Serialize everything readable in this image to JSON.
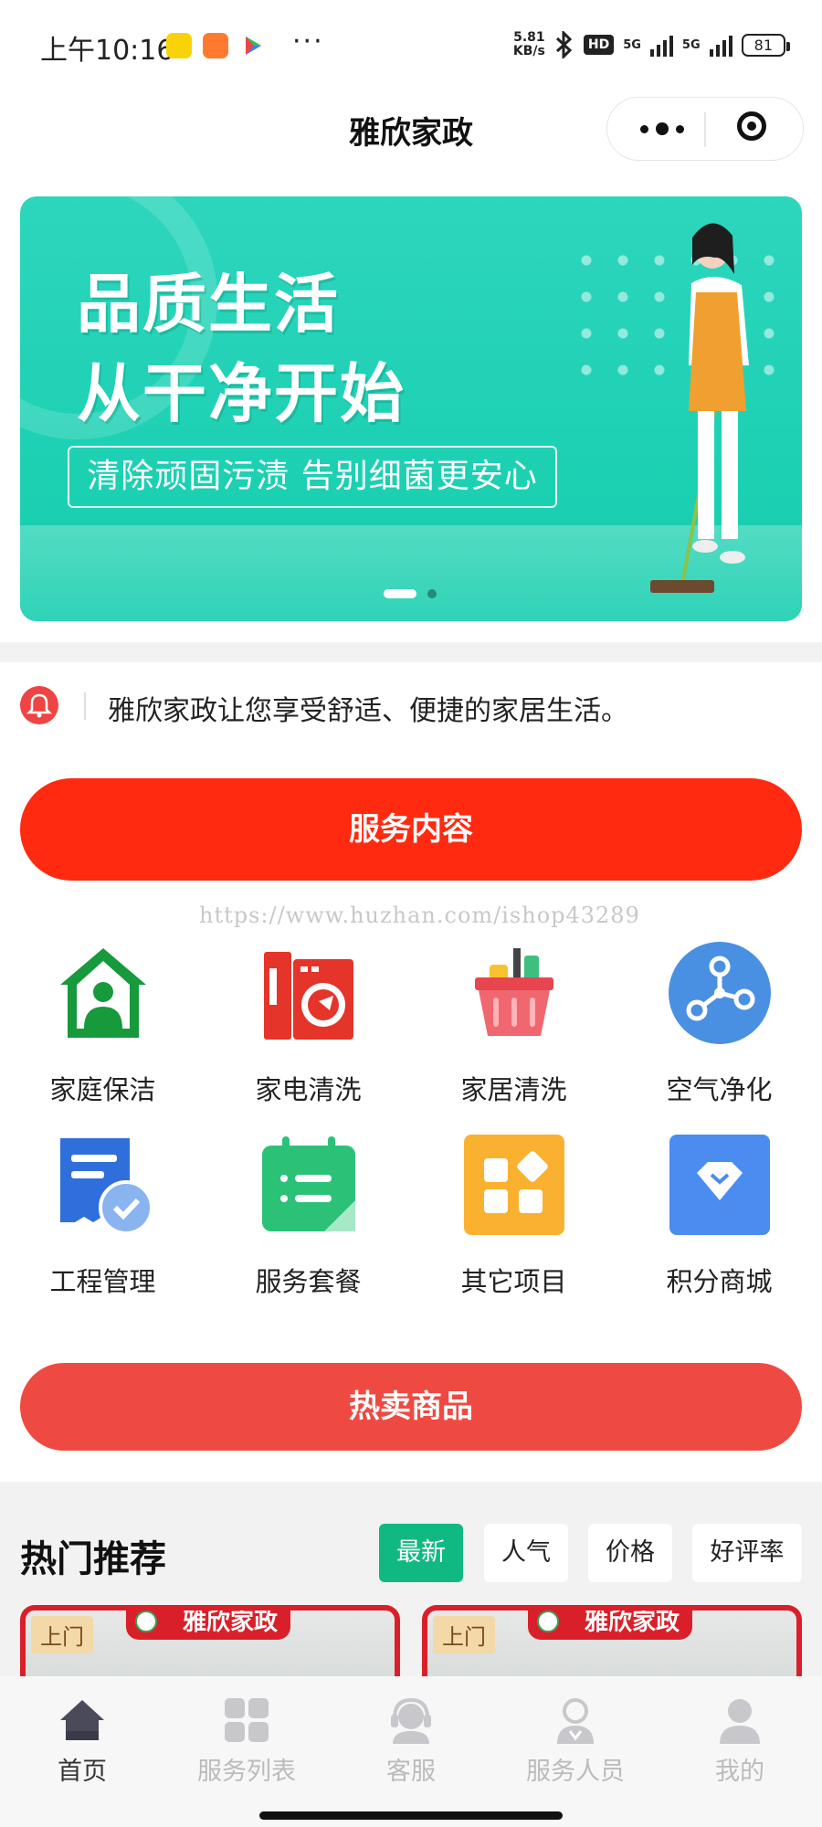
{
  "status_bar": {
    "time": "上午10:16",
    "speed": "5.81",
    "speed_unit": "KB/s",
    "hd": "HD",
    "net1": "5G",
    "net2": "5G",
    "battery": "81"
  },
  "navbar": {
    "title": "雅欣家政"
  },
  "banner": {
    "headline_1": "品质生活",
    "headline_2": "从干净开始",
    "slogan": "清除顽固污渍 告别细菌更安心",
    "page_count": 2,
    "active_page": 1
  },
  "notice": {
    "text": "雅欣家政让您享受舒适、便捷的家居生活。"
  },
  "service_section": {
    "title": "服务内容"
  },
  "watermark": "https://www.huzhan.com/ishop43289",
  "categories": [
    {
      "label": "家庭保洁",
      "icon": "house-person-icon"
    },
    {
      "label": "家电清洗",
      "icon": "washing-machine-icon"
    },
    {
      "label": "家居清洗",
      "icon": "basket-icon"
    },
    {
      "label": "空气净化",
      "icon": "nodes-icon"
    },
    {
      "label": "工程管理",
      "icon": "document-check-icon"
    },
    {
      "label": "服务套餐",
      "icon": "calendar-list-icon"
    },
    {
      "label": "其它项目",
      "icon": "apps-grid-icon"
    },
    {
      "label": "积分商城",
      "icon": "diamond-icon"
    }
  ],
  "hot_products": {
    "title": "热卖商品"
  },
  "recommend": {
    "title": "热门推荐",
    "filters": [
      "最新",
      "人气",
      "价格",
      "好评率"
    ],
    "active_filter": "最新",
    "cards": [
      {
        "tag": "上门",
        "brand": "雅欣家政"
      },
      {
        "tag": "上门",
        "brand": "雅欣家政"
      }
    ]
  },
  "tabbar": {
    "items": [
      {
        "label": "首页",
        "icon": "home-icon"
      },
      {
        "label": "服务列表",
        "icon": "grid-icon"
      },
      {
        "label": "客服",
        "icon": "headset-icon"
      },
      {
        "label": "服务人员",
        "icon": "staff-icon"
      },
      {
        "label": "我的",
        "icon": "user-icon"
      }
    ],
    "active": "首页"
  },
  "colors": {
    "primary_red": "#ff2a10",
    "hot_red": "#ef4a42",
    "banner_teal": "#19cfb0",
    "filter_green": "#10b981"
  }
}
